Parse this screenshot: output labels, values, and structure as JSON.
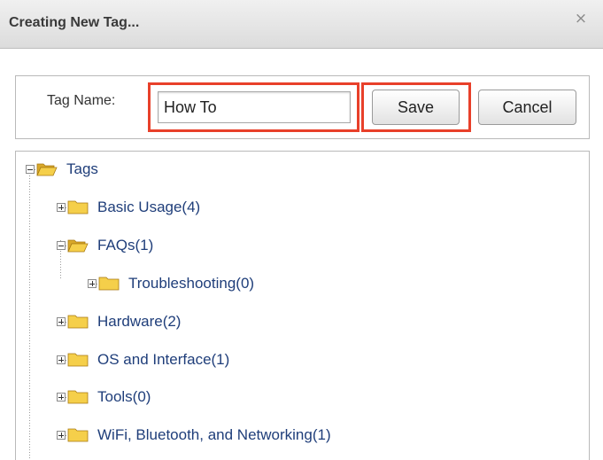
{
  "dialog": {
    "title": "Creating New Tag...",
    "close_glyph": "×"
  },
  "form": {
    "tag_name_label": "Tag Name:",
    "tag_name_value": "How To",
    "save_label": "Save",
    "cancel_label": "Cancel"
  },
  "tree": {
    "root": {
      "label": "Tags",
      "expanded": true
    },
    "items": [
      {
        "label": "Basic Usage(4)",
        "expanded": false
      },
      {
        "label": "FAQs(1)",
        "expanded": true
      },
      {
        "label": "Troubleshooting(0)",
        "expanded": false
      },
      {
        "label": "Hardware(2)",
        "expanded": false
      },
      {
        "label": "OS and Interface(1)",
        "expanded": false
      },
      {
        "label": "Tools(0)",
        "expanded": false
      },
      {
        "label": "WiFi, Bluetooth, and Networking(1)",
        "expanded": false
      }
    ]
  },
  "colors": {
    "highlight": "#e8402a",
    "link": "#1f3e7a",
    "folder": "#f2c532"
  }
}
